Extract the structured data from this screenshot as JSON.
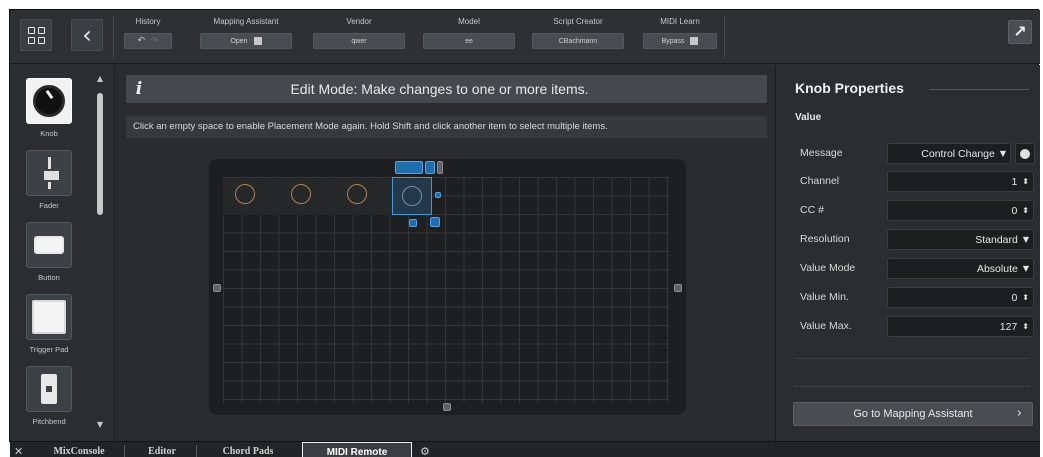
{
  "toolbar": {
    "history": {
      "label": "History",
      "undo": "↶",
      "redo": "↷"
    },
    "mapping_assistant": {
      "label": "Mapping Assistant",
      "value": "Open"
    },
    "vendor": {
      "label": "Vendor",
      "value": "qwer"
    },
    "model": {
      "label": "Model",
      "value": "ee"
    },
    "script_creator": {
      "label": "Script Creator",
      "value": "CBachmann"
    },
    "midi_learn": {
      "label": "MIDI Learn",
      "value": "Bypass"
    }
  },
  "palette": {
    "items": [
      {
        "label": "Knob",
        "icon": "knob-icon",
        "selected": true
      },
      {
        "label": "Fader",
        "icon": "fader-icon",
        "selected": false
      },
      {
        "label": "Button",
        "icon": "button-icon",
        "selected": false
      },
      {
        "label": "Trigger Pad",
        "icon": "trigger-pad-icon",
        "selected": false
      },
      {
        "label": "Pitchbend",
        "icon": "pitchbend-icon",
        "selected": false
      }
    ]
  },
  "editor": {
    "banner_icon": "i",
    "banner_title": "Edit Mode: Make changes to one or more items.",
    "hint": "Click an empty space to enable Placement Mode again. Hold Shift and click another item to select multiple items."
  },
  "properties": {
    "title": "Knob Properties",
    "section": "Value",
    "rows": [
      {
        "label": "Message",
        "value": "Control Change"
      },
      {
        "label": "Channel",
        "value": "1"
      },
      {
        "label": "CC #",
        "value": "0"
      },
      {
        "label": "Resolution",
        "value": "Standard"
      },
      {
        "label": "Value Mode",
        "value": "Absolute"
      },
      {
        "label": "Value Min.",
        "value": "0"
      },
      {
        "label": "Value Max.",
        "value": "127"
      }
    ],
    "goto_button": "Go to Mapping Assistant"
  },
  "tabs": {
    "items": [
      {
        "label": "MixConsole",
        "active": false
      },
      {
        "label": "Editor",
        "active": false
      },
      {
        "label": "Chord Pads",
        "active": false
      },
      {
        "label": "MIDI Remote",
        "active": true
      }
    ]
  },
  "colors": {
    "selection": "#3a9bd8",
    "knob_outline": "#b08050",
    "panel_bg": "#2a2c2f"
  }
}
